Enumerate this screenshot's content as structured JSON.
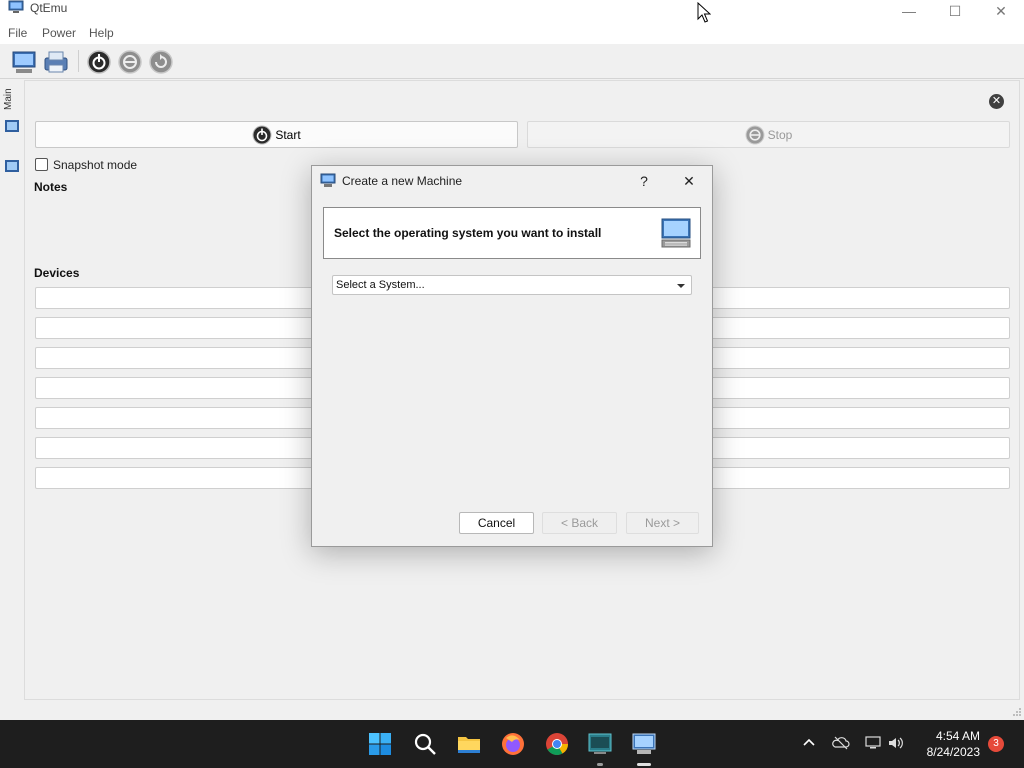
{
  "window": {
    "title": "QtEmu",
    "minimize_glyph": "—",
    "maximize_glyph": "☐",
    "close_glyph": "✕"
  },
  "menubar": {
    "items": [
      "File",
      "Power",
      "Help"
    ]
  },
  "toolbar": {
    "icons": [
      "new-machine-icon",
      "settings-icon",
      "power-on-icon",
      "power-off-icon",
      "reset-icon"
    ]
  },
  "sidebar": {
    "tab_label": "Main",
    "vm_icons": [
      "vm-icon",
      "vm-icon"
    ]
  },
  "main": {
    "start_label": "Start",
    "stop_label": "Stop",
    "snapshot_label": "Snapshot mode",
    "snapshot_checked": false,
    "notes_label": "Notes",
    "devices_label": "Devices",
    "device_rows": 7,
    "close_glyph": "✕"
  },
  "dialog": {
    "title": "Create a new Machine",
    "help_glyph": "?",
    "close_glyph": "✕",
    "heading": "Select the operating system you want to install",
    "select_value": "Select a System...",
    "cancel_label": "Cancel",
    "back_label": "< Back",
    "next_label": "Next >"
  },
  "taskbar": {
    "apps": [
      "windows-start-icon",
      "search-icon",
      "file-explorer-icon",
      "firefox-icon",
      "chrome-icon",
      "terminal-icon",
      "qtemu-icon"
    ],
    "time": "4:54 AM",
    "date": "8/24/2023",
    "notification_count": "3"
  },
  "colors": {
    "taskbar": "#1e1e1e",
    "window_bg": "#f0f0f0",
    "notification_badge": "#e64a3a"
  }
}
